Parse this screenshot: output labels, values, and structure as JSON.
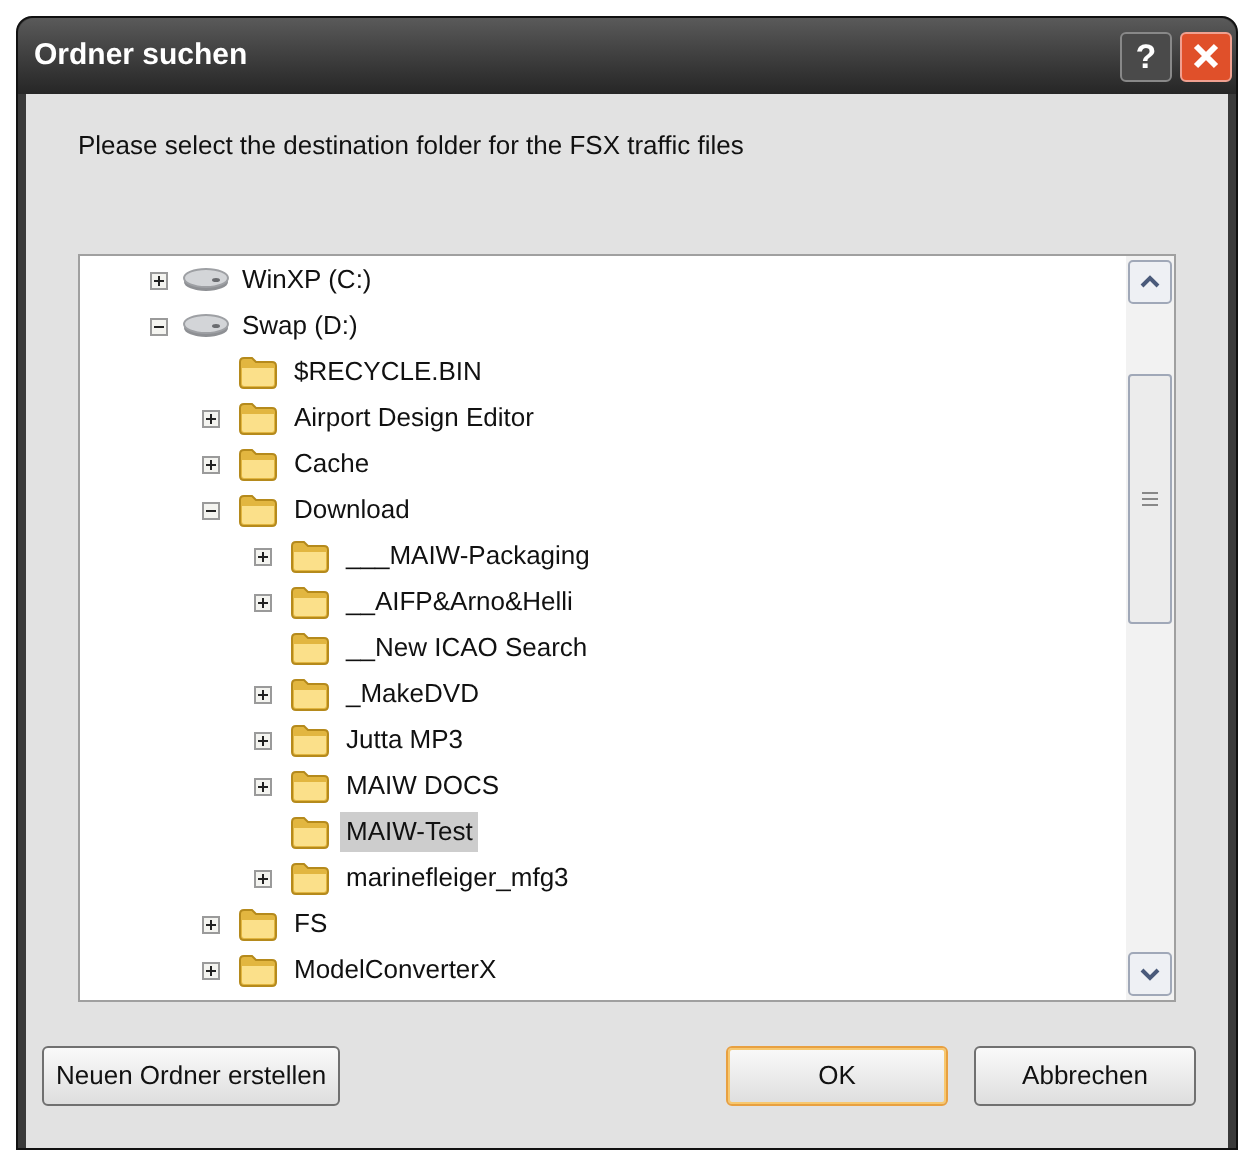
{
  "window": {
    "title": "Ordner suchen",
    "title_buttons": [
      {
        "kind": "help",
        "label": "?"
      },
      {
        "kind": "close"
      }
    ]
  },
  "instruction": "Please select the destination folder for the FSX traffic files",
  "tree": [
    {
      "label": "WinXP (C:)",
      "kind": "drive",
      "expandable": true,
      "expanded": false,
      "selected": false
    },
    {
      "label": "Swap (D:)",
      "kind": "drive",
      "expandable": true,
      "expanded": true,
      "selected": false,
      "children": [
        {
          "label": "$RECYCLE.BIN",
          "kind": "folder",
          "expandable": false,
          "selected": false
        },
        {
          "label": "Airport Design Editor",
          "kind": "folder",
          "expandable": true,
          "expanded": false,
          "selected": false
        },
        {
          "label": "Cache",
          "kind": "folder",
          "expandable": true,
          "expanded": false,
          "selected": false
        },
        {
          "label": "Download",
          "kind": "folder",
          "expandable": true,
          "expanded": true,
          "selected": false,
          "children": [
            {
              "label": "___MAIW-Packaging",
              "kind": "folder",
              "expandable": true,
              "expanded": false,
              "selected": false
            },
            {
              "label": "__AIFP&Arno&Helli",
              "kind": "folder",
              "expandable": true,
              "expanded": false,
              "selected": false
            },
            {
              "label": "__New ICAO Search",
              "kind": "folder",
              "expandable": false,
              "selected": false
            },
            {
              "label": "_MakeDVD",
              "kind": "folder",
              "expandable": true,
              "expanded": false,
              "selected": false
            },
            {
              "label": "Jutta MP3",
              "kind": "folder",
              "expandable": true,
              "expanded": false,
              "selected": false
            },
            {
              "label": "MAIW DOCS",
              "kind": "folder",
              "expandable": true,
              "expanded": false,
              "selected": false
            },
            {
              "label": "MAIW-Test",
              "kind": "folder",
              "expandable": false,
              "selected": true
            },
            {
              "label": "marinefleiger_mfg3",
              "kind": "folder",
              "expandable": true,
              "expanded": false,
              "selected": false
            }
          ]
        },
        {
          "label": "FS",
          "kind": "folder",
          "expandable": true,
          "expanded": false,
          "selected": false
        },
        {
          "label": "ModelConverterX",
          "kind": "folder",
          "expandable": true,
          "expanded": false,
          "selected": false
        }
      ]
    }
  ],
  "buttons": [
    {
      "label": "Neuen Ordner erstellen",
      "default": false
    },
    {
      "label": "OK",
      "default": true
    },
    {
      "label": "Abbrechen",
      "default": false
    }
  ]
}
